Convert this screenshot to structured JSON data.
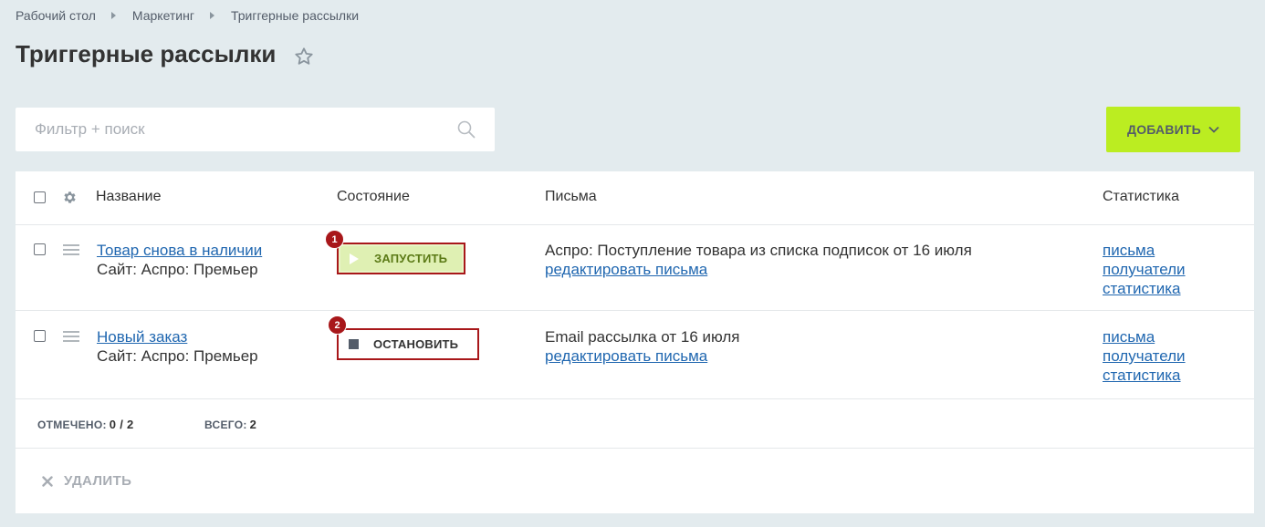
{
  "breadcrumb": [
    "Рабочий стол",
    "Маркетинг",
    "Триггерные рассылки"
  ],
  "page_title": "Триггерные рассылки",
  "search": {
    "placeholder": "Фильтр + поиск"
  },
  "add_button": "ДОБАВИТЬ",
  "table": {
    "columns": [
      "Название",
      "Состояние",
      "Письма",
      "Статистика"
    ],
    "rows": [
      {
        "name": "Товар снова в наличии",
        "site": "Сайт: Аспро: Премьер",
        "badge": "1",
        "state_button": "ЗАПУСТИТЬ",
        "letter": "Аспро: Поступление товара из списка подписок от 16 июля",
        "edit_link": "редактировать письма",
        "stats": [
          "письма",
          "получатели",
          "статистика"
        ]
      },
      {
        "name": "Новый заказ",
        "site": "Сайт: Аспро: Премьер",
        "badge": "2",
        "state_button": "ОСТАНОВИТЬ",
        "letter": "Email рассылка от 16 июля",
        "edit_link": "редактировать письма",
        "stats": [
          "письма",
          "получатели",
          "статистика"
        ]
      }
    ]
  },
  "footer": {
    "selected_label": "ОТМЕЧЕНО:",
    "selected_value": "0 / 2",
    "total_label": "ВСЕГО:",
    "total_value": "2"
  },
  "delete_button": "УДАЛИТЬ",
  "colors": {
    "accent": "#bbed21",
    "link": "#2067b0",
    "highlight": "#a8171a"
  }
}
